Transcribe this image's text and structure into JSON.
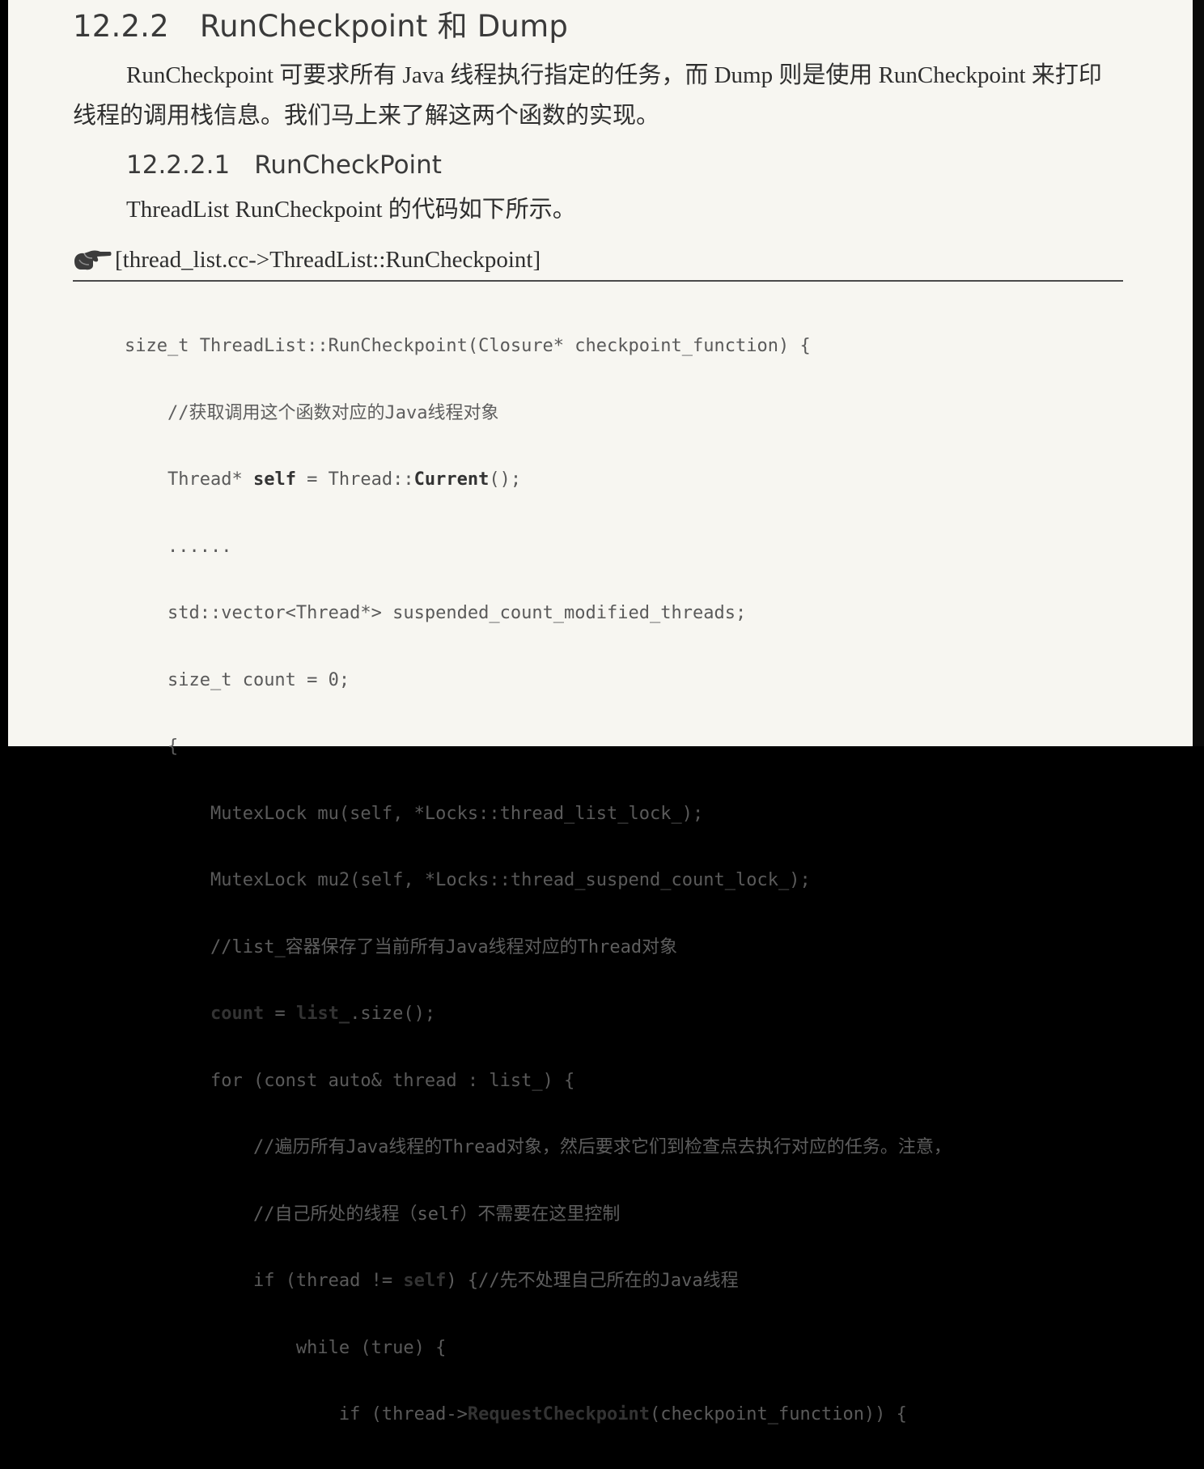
{
  "section": {
    "number": "12.2.2",
    "title": "RunCheckpoint 和 Dump"
  },
  "intro_paragraph": "RunCheckpoint 可要求所有 Java 线程执行指定的任务，而 Dump 则是使用 RunCheckpoint 来打印线程的调用栈信息。我们马上来了解这两个函数的实现。",
  "subsection": {
    "number": "12.2.2.1",
    "title": "RunCheckPoint"
  },
  "subsection_paragraph": "ThreadList RunCheckpoint 的代码如下所示。",
  "file_ref": {
    "icon": "pointing-hand-icon",
    "label": "[thread_list.cc->ThreadList::RunCheckpoint]"
  },
  "code": {
    "l1": "size_t ThreadList::RunCheckpoint(Closure* checkpoint_function) {",
    "l2": "//获取调用这个函数对应的Java线程对象",
    "l3_a": "Thread* ",
    "l3_b": "self",
    "l3_c": " = Thread::",
    "l3_d": "Current",
    "l3_e": "();",
    "l4": "......",
    "l5": "std::vector<Thread*> suspended_count_modified_threads;",
    "l6": "size_t count = 0;",
    "l7": "{",
    "l8": "MutexLock mu(self, *Locks::thread_list_lock_);",
    "l9": "MutexLock mu2(self, *Locks::thread_suspend_count_lock_);",
    "l10": "//list_容器保存了当前所有Java线程对应的Thread对象",
    "l11_a": "count",
    "l11_b": " = ",
    "l11_c": "list_",
    "l11_d": ".size();",
    "l12": "for (const auto& thread : list_) {",
    "l13": "//遍历所有Java线程的Thread对象，然后要求它们到检查点去执行对应的任务。注意，",
    "l14": "//自己所处的线程（self）不需要在这里控制",
    "l15_a": "if (thread != ",
    "l15_b": "self",
    "l15_c": ") {//先不处理自己所在的Java线程",
    "l16": "while (true) {",
    "l17_a": "if (thread->",
    "l17_b": "RequestCheckpoint",
    "l17_c": "(checkpoint_function)) {"
  },
  "colors": {
    "page_background": "#f7f6f1",
    "text": "#2e2e2e",
    "code_text": "#5a5a5a"
  }
}
